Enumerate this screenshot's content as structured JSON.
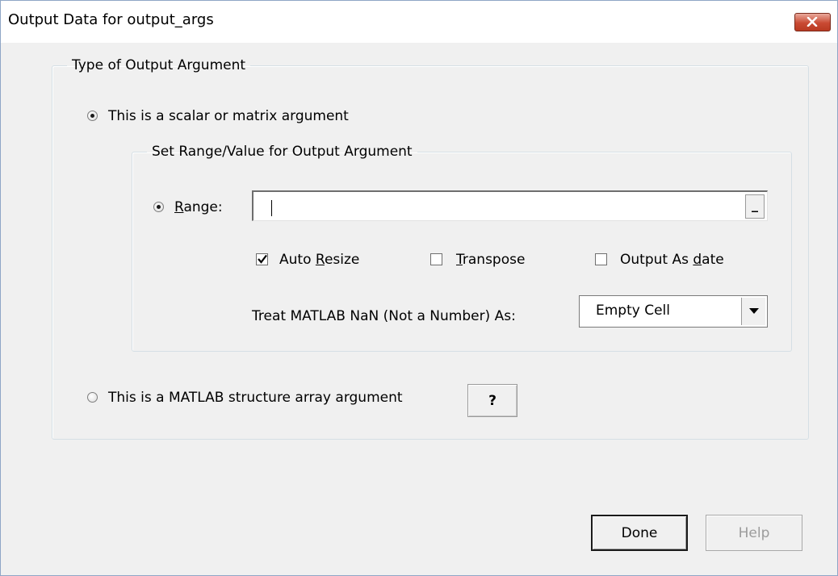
{
  "window": {
    "title": "Output Data for output_args",
    "close_glyph": "close-icon"
  },
  "type_group": {
    "legend": "Type of Output Argument",
    "option_scalar": {
      "label": "This is a scalar or matrix argument",
      "selected": true
    },
    "option_struct": {
      "label": "This is a MATLAB structure array argument",
      "selected": false
    },
    "help_question_label": "?"
  },
  "range_group": {
    "legend": "Set Range/Value for Output Argument",
    "range_radio": {
      "label_pre": "",
      "label_accel": "R",
      "label_post": "ange:",
      "selected": true
    },
    "range_input": {
      "value": ""
    },
    "range_select_label": "_",
    "auto_resize": {
      "label_pre": "Auto ",
      "label_accel": "R",
      "label_post": "esize",
      "checked": true
    },
    "transpose": {
      "label_pre": "",
      "label_accel": "T",
      "label_post": "ranspose",
      "checked": false
    },
    "output_as_date": {
      "label_pre": "Output As ",
      "label_accel": "d",
      "label_post": "ate",
      "checked": false
    },
    "nan_label": "Treat MATLAB NaN (Not a Number) As:",
    "nan_select": {
      "value": "Empty Cell"
    }
  },
  "buttons": {
    "done": "Done",
    "help": "Help"
  },
  "colors": {
    "dialog_bg": "#f0f0f0",
    "close_button": "#c94a33",
    "disabled_text": "#9c9c9c"
  }
}
